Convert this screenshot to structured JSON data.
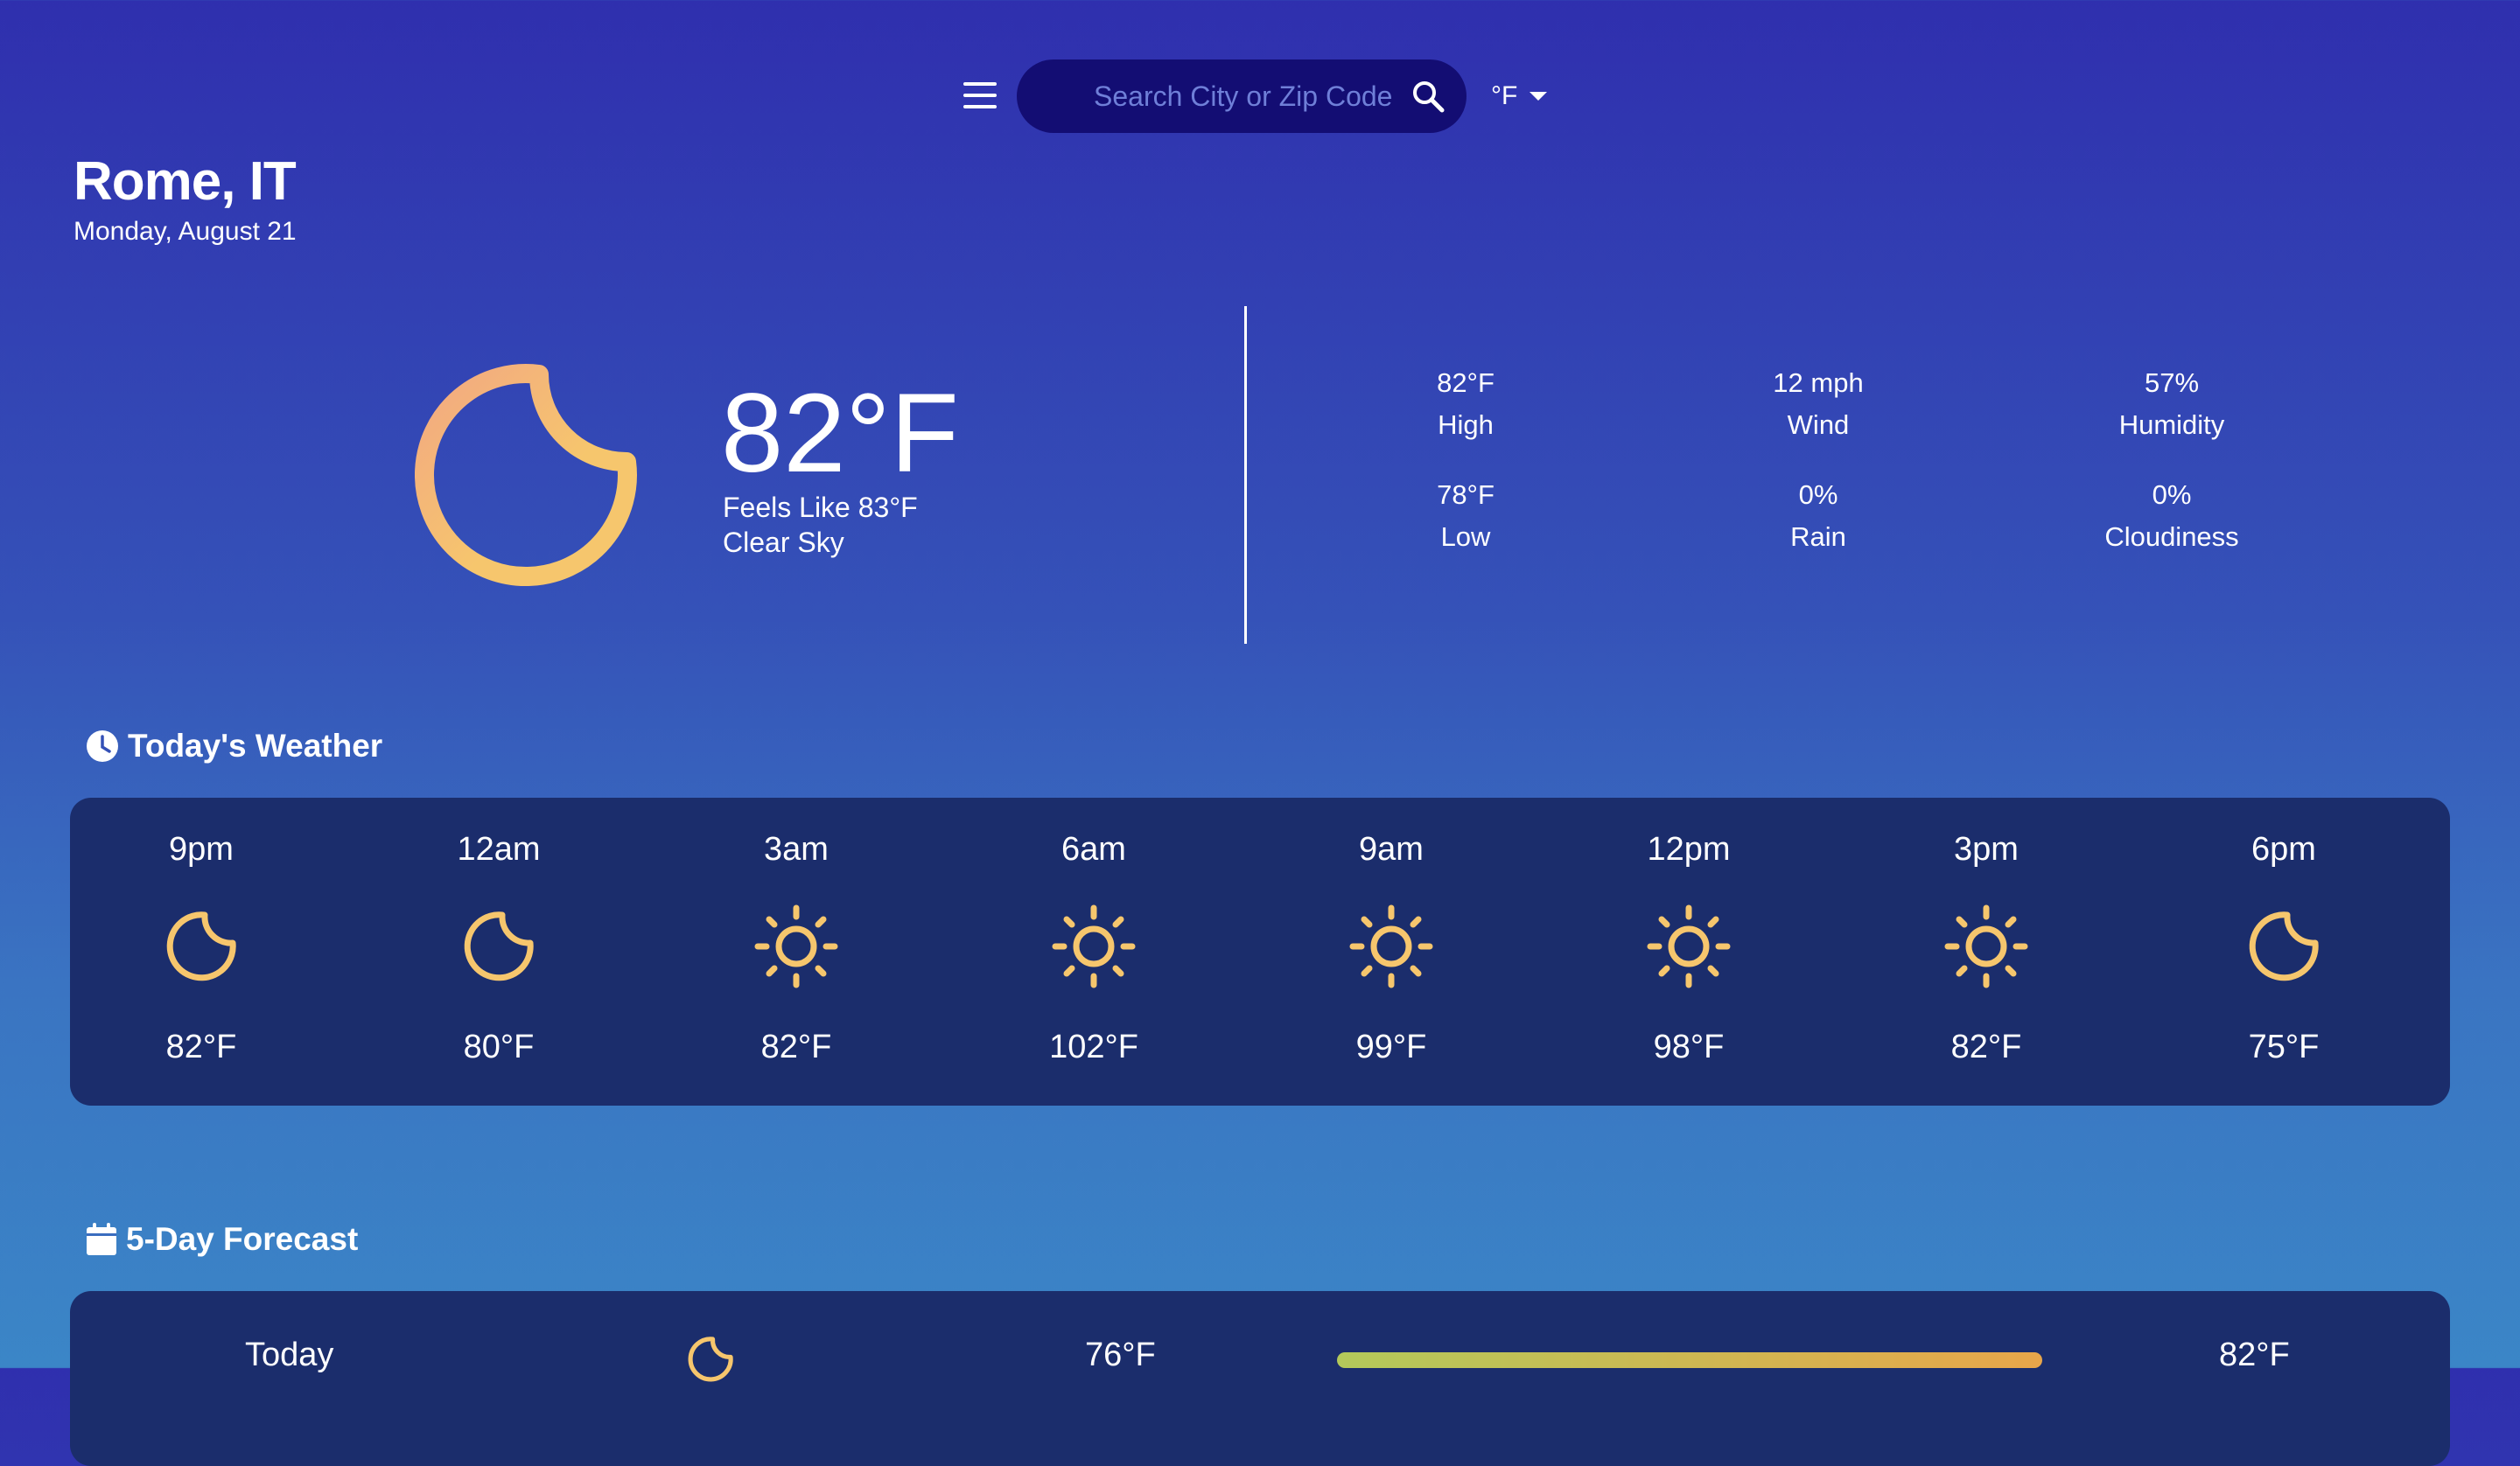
{
  "search": {
    "placeholder": "Search City or Zip Code"
  },
  "unit": {
    "selected": "°F"
  },
  "location": {
    "city": "Rome, IT",
    "date": "Monday, August 21"
  },
  "current": {
    "temp": "82°F",
    "feels_like": "Feels Like 83°F",
    "condition": "Clear Sky",
    "icon": "moon-icon"
  },
  "stats": [
    {
      "value": "82°F",
      "label": "High"
    },
    {
      "value": "12 mph",
      "label": "Wind"
    },
    {
      "value": "57%",
      "label": "Humidity"
    },
    {
      "value": "78°F",
      "label": "Low"
    },
    {
      "value": "0%",
      "label": "Rain"
    },
    {
      "value": "0%",
      "label": "Cloudiness"
    }
  ],
  "today": {
    "title": "Today's Weather",
    "icon": "clock-icon",
    "hours": [
      {
        "time": "9pm",
        "icon": "moon-icon",
        "temp": "82°F"
      },
      {
        "time": "12am",
        "icon": "moon-icon",
        "temp": "80°F"
      },
      {
        "time": "3am",
        "icon": "sun-icon",
        "temp": "82°F"
      },
      {
        "time": "6am",
        "icon": "sun-icon",
        "temp": "102°F"
      },
      {
        "time": "9am",
        "icon": "sun-icon",
        "temp": "99°F"
      },
      {
        "time": "12pm",
        "icon": "sun-icon",
        "temp": "98°F"
      },
      {
        "time": "3pm",
        "icon": "sun-icon",
        "temp": "82°F"
      },
      {
        "time": "6pm",
        "icon": "moon-icon",
        "temp": "75°F"
      }
    ]
  },
  "forecast": {
    "title": "5-Day Forecast",
    "icon": "calendar-icon",
    "days": [
      {
        "day": "Today",
        "icon": "moon-icon",
        "low": "76°F",
        "high": "82°F"
      }
    ]
  },
  "colors": {
    "icon_yellow": "#f6c66d",
    "icon_peach": "#f2a882",
    "panel": "#1b2d6c",
    "search_bg": "#130d73"
  }
}
